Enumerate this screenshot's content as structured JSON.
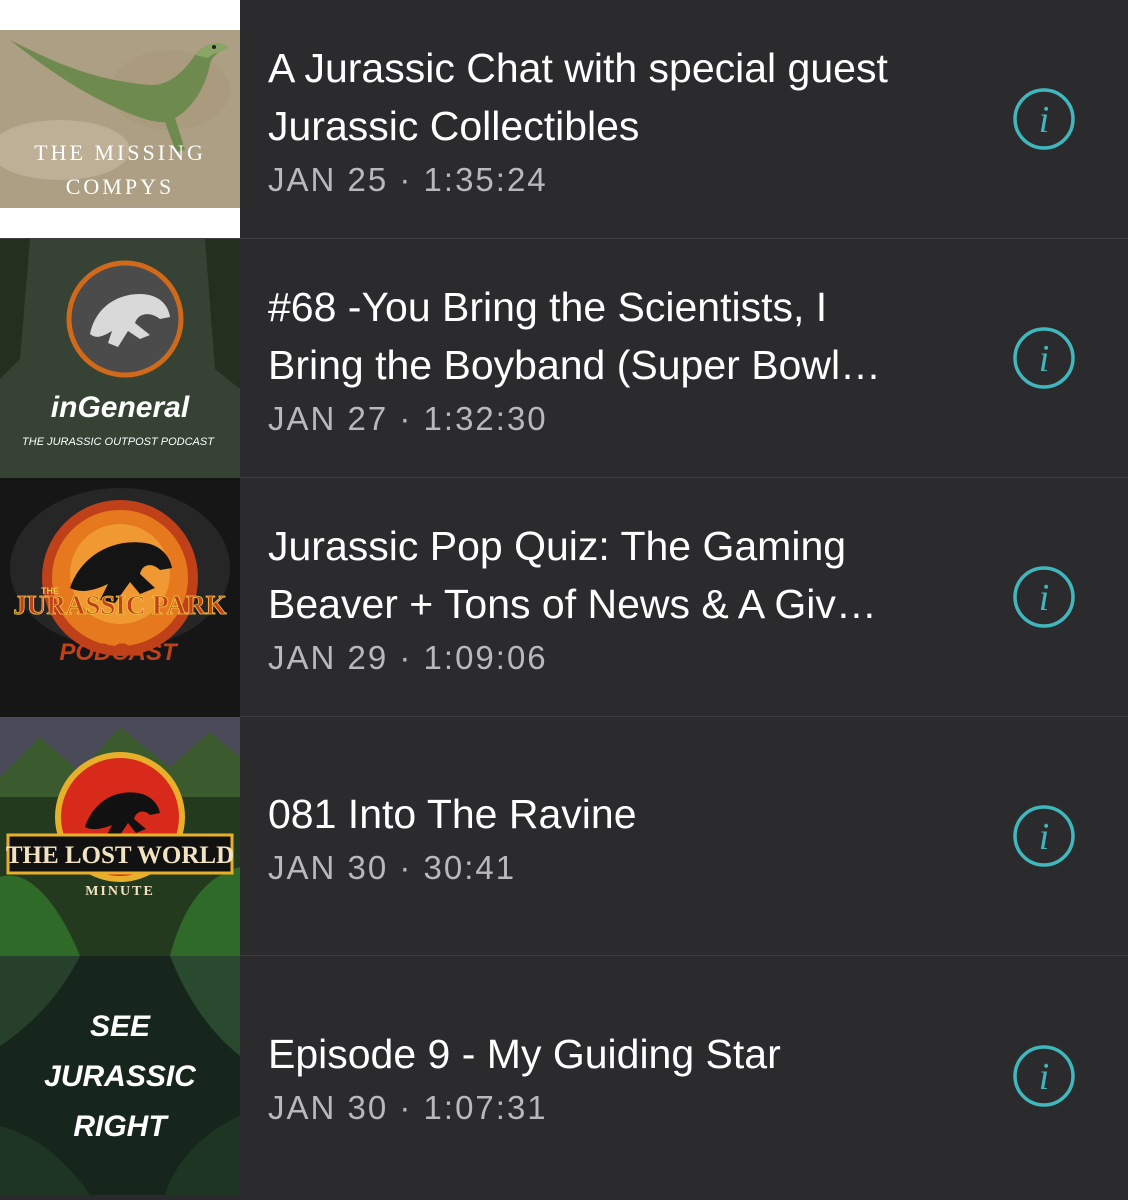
{
  "colors": {
    "background": "#2b2b2d",
    "title": "#ffffff",
    "meta": "#b9b9bd",
    "accent": "#3fb7bd",
    "divider": "#3d3d40"
  },
  "episodes": [
    {
      "thumb_text": [
        "THE MISSING",
        "COMPYS"
      ],
      "title": "A Jurassic Chat with special guest Jurassic Collectibles",
      "date": "JAN 25",
      "duration": "1:35:24",
      "info_icon": "info-icon"
    },
    {
      "thumb_text": [
        "inGeneral",
        "THE JURASSIC OUTPOST PODCAST"
      ],
      "title": "#68 -You Bring the Scientists, I Bring the Boyband (Super Bowl…",
      "date": "JAN 27",
      "duration": "1:32:30",
      "info_icon": "info-icon"
    },
    {
      "thumb_text": [
        "THE",
        "JURASSIC PARK",
        "PODCAST"
      ],
      "title": "Jurassic Pop Quiz: The Gaming Beaver + Tons of News & A Giv…",
      "date": "JAN 29",
      "duration": "1:09:06",
      "info_icon": "info-icon"
    },
    {
      "thumb_text": [
        "THE LOST WORLD",
        "MINUTE"
      ],
      "title": "081 Into The Ravine",
      "date": "JAN 30",
      "duration": "30:41",
      "info_icon": "info-icon"
    },
    {
      "thumb_text": [
        "SEE",
        "JURASSIC",
        "RIGHT"
      ],
      "title": "Episode 9 - My Guiding Star",
      "date": "JAN 30",
      "duration": "1:07:31",
      "info_icon": "info-icon"
    }
  ],
  "meta_separator": " · "
}
